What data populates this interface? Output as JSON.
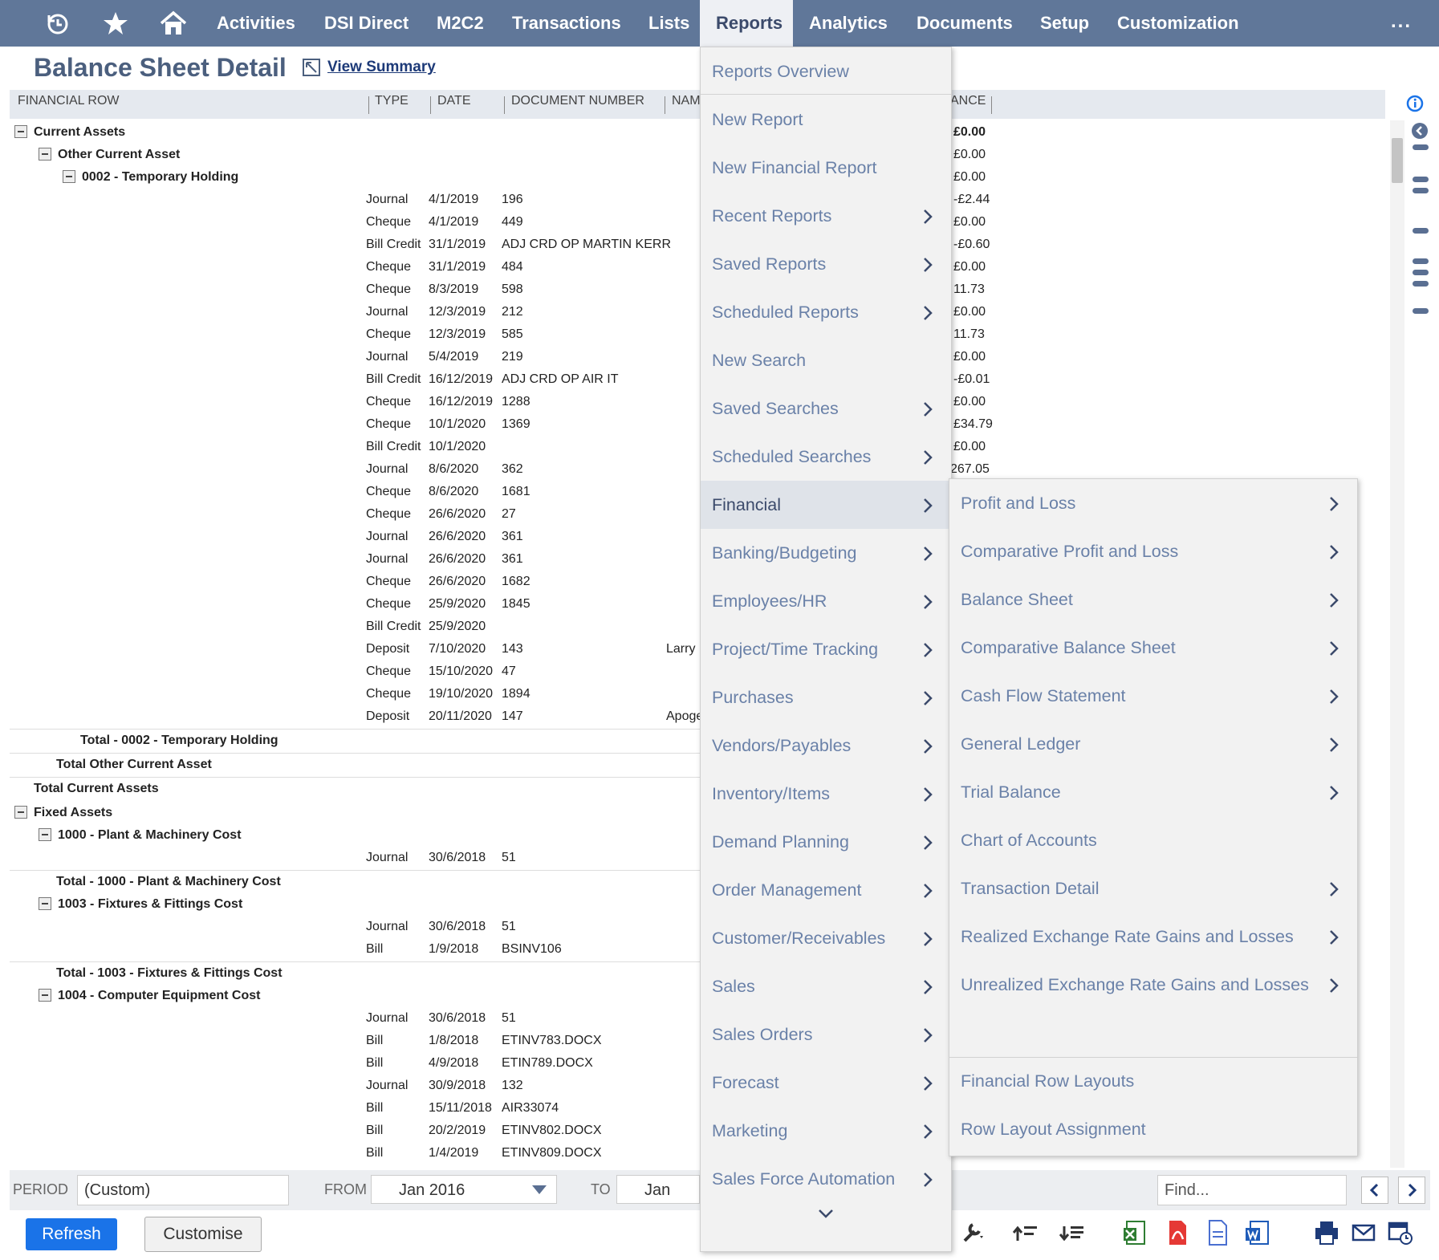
{
  "nav": {
    "items": [
      "Activities",
      "DSI Direct",
      "M2C2",
      "Transactions",
      "Lists",
      "Reports",
      "Analytics",
      "Documents",
      "Setup",
      "Customization"
    ],
    "active": "Reports",
    "more": "..."
  },
  "page": {
    "title": "Balance Sheet Detail",
    "view_summary": "View Summary"
  },
  "table": {
    "headers": [
      "FINANCIAL ROW",
      "TYPE",
      "DATE",
      "DOCUMENT NUMBER",
      "NAM",
      "ANCE"
    ],
    "sections": [
      {
        "label": "Current Assets",
        "level": 0,
        "balance": "£0.00"
      },
      {
        "label": "Other Current Asset",
        "level": 1,
        "balance": "£0.00"
      },
      {
        "label": "0002 - Temporary Holding",
        "level": 2,
        "balance": "£0.00"
      }
    ],
    "rows": [
      {
        "type": "Journal",
        "date": "4/1/2019",
        "doc": "196",
        "name": "",
        "bal": "-£2.44"
      },
      {
        "type": "Cheque",
        "date": "4/1/2019",
        "doc": "449",
        "name": "",
        "bal": "£0.00"
      },
      {
        "type": "Bill Credit",
        "date": "31/1/2019",
        "doc": "ADJ CRD OP MARTIN KERR",
        "name": "",
        "bal": "-£0.60"
      },
      {
        "type": "Cheque",
        "date": "31/1/2019",
        "doc": "484",
        "name": "",
        "bal": "£0.00"
      },
      {
        "type": "Cheque",
        "date": "8/3/2019",
        "doc": "598",
        "name": "",
        "bal": "11.73"
      },
      {
        "type": "Journal",
        "date": "12/3/2019",
        "doc": "212",
        "name": "",
        "bal": "£0.00"
      },
      {
        "type": "Cheque",
        "date": "12/3/2019",
        "doc": "585",
        "name": "",
        "bal": "11.73"
      },
      {
        "type": "Journal",
        "date": "5/4/2019",
        "doc": "219",
        "name": "",
        "bal": "£0.00"
      },
      {
        "type": "Bill Credit",
        "date": "16/12/2019",
        "doc": "ADJ CRD OP AIR IT",
        "name": "",
        "bal": "-£0.01"
      },
      {
        "type": "Cheque",
        "date": "16/12/2019",
        "doc": "1288",
        "name": "",
        "bal": "£0.00"
      },
      {
        "type": "Cheque",
        "date": "10/1/2020",
        "doc": "1369",
        "name": "",
        "bal": "£34.79"
      },
      {
        "type": "Bill Credit",
        "date": "10/1/2020",
        "doc": "",
        "name": "",
        "bal": "£0.00"
      },
      {
        "type": "Journal",
        "date": "8/6/2020",
        "doc": "362",
        "name": "",
        "bal": "267.05"
      },
      {
        "type": "Cheque",
        "date": "8/6/2020",
        "doc": "1681",
        "name": "",
        "bal": ""
      },
      {
        "type": "Cheque",
        "date": "26/6/2020",
        "doc": "27",
        "name": "",
        "bal": ""
      },
      {
        "type": "Journal",
        "date": "26/6/2020",
        "doc": "361",
        "name": "",
        "bal": ""
      },
      {
        "type": "Journal",
        "date": "26/6/2020",
        "doc": "361",
        "name": "",
        "bal": ""
      },
      {
        "type": "Cheque",
        "date": "26/6/2020",
        "doc": "1682",
        "name": "",
        "bal": ""
      },
      {
        "type": "Cheque",
        "date": "25/9/2020",
        "doc": "1845",
        "name": "",
        "bal": ""
      },
      {
        "type": "Bill Credit",
        "date": "25/9/2020",
        "doc": "",
        "name": "",
        "bal": ""
      },
      {
        "type": "Deposit",
        "date": "7/10/2020",
        "doc": "143",
        "name": "Larry",
        "bal": ""
      },
      {
        "type": "Cheque",
        "date": "15/10/2020",
        "doc": "47",
        "name": "",
        "bal": ""
      },
      {
        "type": "Cheque",
        "date": "19/10/2020",
        "doc": "1894",
        "name": "",
        "bal": ""
      },
      {
        "type": "Deposit",
        "date": "20/11/2020",
        "doc": "147",
        "name": "Apoge",
        "bal": ""
      }
    ],
    "totals_a": [
      "Total - 0002 - Temporary Holding",
      "Total Other Current Asset",
      "Total Current Assets"
    ],
    "fixed": {
      "label": "Fixed Assets",
      "g1": "1000 - Plant & Machinery Cost",
      "g1_rows": [
        {
          "type": "Journal",
          "date": "30/6/2018",
          "doc": "51"
        }
      ],
      "g1_total": "Total - 1000 - Plant & Machinery Cost",
      "g2": "1003 - Fixtures & Fittings Cost",
      "g2_rows": [
        {
          "type": "Journal",
          "date": "30/6/2018",
          "doc": "51"
        },
        {
          "type": "Bill",
          "date": "1/9/2018",
          "doc": "BSINV106"
        }
      ],
      "g2_total": "Total - 1003 - Fixtures & Fittings Cost",
      "g3": "1004 - Computer Equipment Cost",
      "g3_rows": [
        {
          "type": "Journal",
          "date": "30/6/2018",
          "doc": "51"
        },
        {
          "type": "Bill",
          "date": "1/8/2018",
          "doc": "ETINV783.DOCX"
        },
        {
          "type": "Bill",
          "date": "4/9/2018",
          "doc": "ETIN789.DOCX"
        },
        {
          "type": "Journal",
          "date": "30/9/2018",
          "doc": "132"
        },
        {
          "type": "Bill",
          "date": "15/11/2018",
          "doc": "AIR33074"
        },
        {
          "type": "Bill",
          "date": "20/2/2019",
          "doc": "ETINV802.DOCX"
        },
        {
          "type": "Bill",
          "date": "1/4/2019",
          "doc": "ETINV809.DOCX"
        }
      ]
    }
  },
  "filters": {
    "period_label": "PERIOD",
    "period_value": "(Custom)",
    "from_label": "FROM",
    "from_value": "Jan 2016",
    "to_label": "TO",
    "to_value": "Jan 2021",
    "find_placeholder": "Find..."
  },
  "buttons": {
    "refresh": "Refresh",
    "customise": "Customise"
  },
  "reports_menu": [
    {
      "label": "Reports Overview",
      "sub": false
    },
    {
      "label": "New Report",
      "sub": false
    },
    {
      "label": "New Financial Report",
      "sub": false
    },
    {
      "label": "Recent Reports",
      "sub": true
    },
    {
      "label": "Saved Reports",
      "sub": true
    },
    {
      "label": "Scheduled Reports",
      "sub": true
    },
    {
      "label": "New Search",
      "sub": false
    },
    {
      "label": "Saved Searches",
      "sub": true
    },
    {
      "label": "Scheduled Searches",
      "sub": true
    },
    {
      "label": "Financial",
      "sub": true
    },
    {
      "label": "Banking/Budgeting",
      "sub": true
    },
    {
      "label": "Employees/HR",
      "sub": true
    },
    {
      "label": "Project/Time Tracking",
      "sub": true
    },
    {
      "label": "Purchases",
      "sub": true
    },
    {
      "label": "Vendors/Payables",
      "sub": true
    },
    {
      "label": "Inventory/Items",
      "sub": true
    },
    {
      "label": "Demand Planning",
      "sub": true
    },
    {
      "label": "Order Management",
      "sub": true
    },
    {
      "label": "Customer/Receivables",
      "sub": true
    },
    {
      "label": "Sales",
      "sub": true
    },
    {
      "label": "Sales Orders",
      "sub": true
    },
    {
      "label": "Forecast",
      "sub": true
    },
    {
      "label": "Marketing",
      "sub": true
    },
    {
      "label": "Sales Force Automation",
      "sub": true
    }
  ],
  "financial_menu": [
    {
      "label": "Profit and Loss",
      "sub": true
    },
    {
      "label": "Comparative Profit and Loss",
      "sub": true
    },
    {
      "label": "Balance Sheet",
      "sub": true
    },
    {
      "label": "Comparative Balance Sheet",
      "sub": true
    },
    {
      "label": "Cash Flow Statement",
      "sub": true
    },
    {
      "label": "General Ledger",
      "sub": true
    },
    {
      "label": "Trial Balance",
      "sub": true
    },
    {
      "label": "Chart of Accounts",
      "sub": false
    },
    {
      "label": "Transaction Detail",
      "sub": true
    },
    {
      "label": "Realized Exchange Rate Gains and Losses",
      "sub": true
    },
    {
      "label": "Unrealized Exchange Rate Gains and Losses",
      "sub": true
    },
    {
      "label": "Financial Row Layouts",
      "sub": false
    },
    {
      "label": "Row Layout Assignment",
      "sub": false
    }
  ]
}
